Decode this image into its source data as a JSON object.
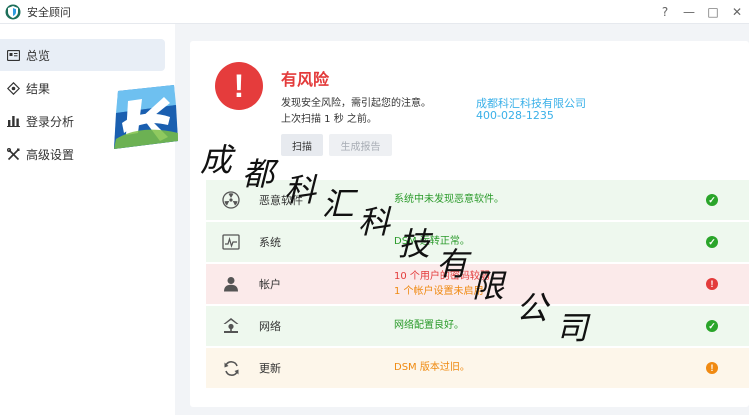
{
  "window": {
    "title": "安全顾问",
    "controls": {
      "help": "?",
      "minimize": "—",
      "maximize": "□",
      "close": "✕"
    }
  },
  "sidebar": {
    "items": [
      {
        "label": "总览",
        "icon": "overview-icon",
        "active": true
      },
      {
        "label": "结果",
        "icon": "results-icon",
        "active": false
      },
      {
        "label": "登录分析",
        "icon": "bar-chart-icon",
        "active": false
      },
      {
        "label": "高级设置",
        "icon": "tools-icon",
        "active": false
      }
    ]
  },
  "summary": {
    "status_title": "有风险",
    "alert_glyph": "!",
    "description": "发现安全风险，需引起您的注意。",
    "last_scan": "上次扫描 1 秒 之前。",
    "scan_button": "扫描",
    "report_button": "生成报告"
  },
  "contact": {
    "company": "成都科汇科技有限公司",
    "phone": "400-028-1235"
  },
  "categories": [
    {
      "name": "恶意软件",
      "icon": "malware-icon",
      "status_lines": [
        "系统中未发现恶意软件。"
      ],
      "level": "ok",
      "badge": "✓"
    },
    {
      "name": "系统",
      "icon": "system-icon",
      "status_lines": [
        "DSM 运转正常。"
      ],
      "level": "ok",
      "badge": "✓"
    },
    {
      "name": "帐户",
      "icon": "account-icon",
      "status_lines": [
        "10 个用户的密码较弱",
        "1 个帐户设置未启用"
      ],
      "level": "danger",
      "badge": "!"
    },
    {
      "name": "网络",
      "icon": "network-icon",
      "status_lines": [
        "网络配置良好。"
      ],
      "level": "ok",
      "badge": "✓"
    },
    {
      "name": "更新",
      "icon": "update-icon",
      "status_lines": [
        "DSM 版本过旧。"
      ],
      "level": "warning",
      "badge": "!"
    }
  ],
  "watermark": {
    "text": [
      "成",
      "都",
      "科",
      "汇",
      "科",
      "技",
      "有",
      "限",
      "公",
      "司"
    ]
  },
  "colors": {
    "danger": "#e33b3b",
    "ok": "#2a9a2a",
    "warning": "#ef8a11",
    "contact": "#3ab0e8"
  }
}
